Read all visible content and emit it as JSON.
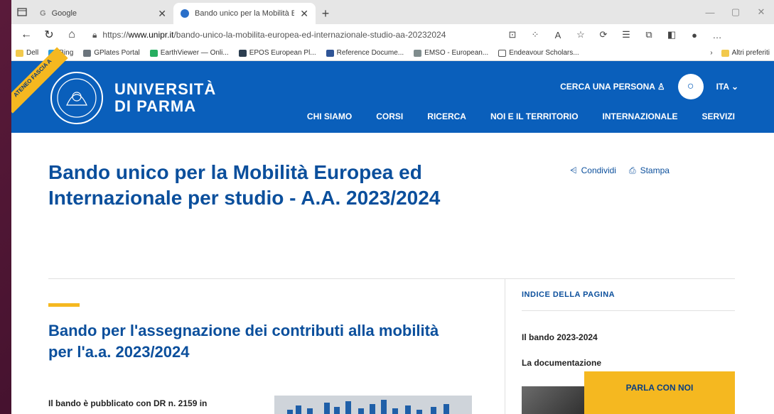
{
  "browser": {
    "tabs": [
      {
        "title": "Google",
        "favicon": "google-icon"
      },
      {
        "title": "Bando unico per la Mobilità Euro",
        "favicon": "site-icon"
      }
    ],
    "new_tab": "+",
    "url_prefix": "https://",
    "url_domain": "www.unipr.it",
    "url_path": "/bando-unico-la-mobilita-europea-ed-internazionale-studio-aa-20232024",
    "bookmarks": [
      {
        "label": "Dell",
        "color": "#f2c94c"
      },
      {
        "label": "Bing",
        "color": "#2d9cdb"
      },
      {
        "label": "GPlates Portal",
        "color": "#6c757d"
      },
      {
        "label": "EarthViewer — Onli...",
        "color": "#27ae60"
      },
      {
        "label": "EPOS European Pl...",
        "color": "#2c3e50"
      },
      {
        "label": "Reference Docume...",
        "color": "#2f5597"
      },
      {
        "label": "EMSO - European...",
        "color": "#7f8c8d"
      },
      {
        "label": "Endeavour Scholars...",
        "color": "#ffffff"
      }
    ],
    "bookmarks_other": "Altri preferiti"
  },
  "site": {
    "ribbon": "ATENEO FASCIA A",
    "brand_line1": "UNIVERSITÀ",
    "brand_line2": "DI PARMA",
    "search_person": "CERCA UNA PERSONA",
    "language": "ITA",
    "nav": [
      "CHI SIAMO",
      "CORSI",
      "RICERCA",
      "NOI E IL TERRITORIO",
      "INTERNAZIONALE",
      "SERVIZI"
    ]
  },
  "page": {
    "title": "Bando unico per la Mobilità Europea ed Internazionale per studio - A.A. 2023/2024",
    "share": "Condividi",
    "print": "Stampa",
    "section_title": "Bando per l'assegnazione dei contributi alla mobilità per l'a.a. 2023/2024",
    "body_text": "Il bando è pubblicato con DR n. 2159 in",
    "index_heading": "INDICE DELLA PAGINA",
    "index_items": [
      "Il bando 2023-2024",
      "La documentazione"
    ],
    "contact_button": "PARLA CON NOI"
  },
  "colors": {
    "brand_blue": "#0a5fbb",
    "title_blue": "#0b4f9c",
    "accent_yellow": "#f5b820"
  }
}
